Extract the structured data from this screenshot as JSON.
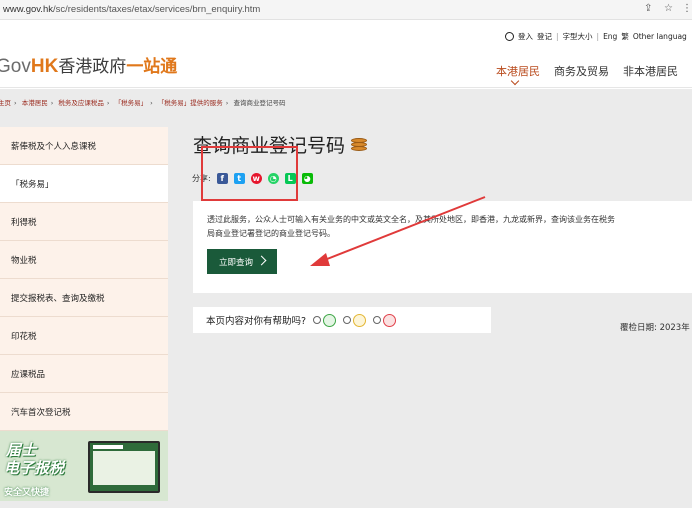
{
  "browser": {
    "url_host": "www.gov.hk",
    "url_path": "/sc/residents/taxes/etax/services/brn_enquiry.htm"
  },
  "header": {
    "logo_gov": "Gov",
    "logo_hk": "HK",
    "logo_cn1": "香港政府",
    "logo_cn2": "一站通",
    "top_links": {
      "login": "登入",
      "register": "登记",
      "font_size": "字型大小",
      "lang_en": "Eng",
      "lang_trad": "繁",
      "other_lang": "Other languag"
    },
    "nav": [
      "本港居民",
      "商务及贸易",
      "非本港居民"
    ]
  },
  "breadcrumb": [
    "主页",
    "本港居民",
    "税务及应课税品",
    "「税务易」",
    "「税务易」提供的服务",
    "查询商业登记号码"
  ],
  "sidebar": {
    "items": [
      "薪俸税及个人入息课税",
      "「税务易」",
      "利得税",
      "物业税",
      "提交报税表、查询及缴税",
      "印花税",
      "应课税品",
      "汽车首次登记税"
    ],
    "banner_line1": "届士",
    "banner_line2": "电子报税",
    "banner_line3": "安全又快捷"
  },
  "main": {
    "title": "查询商业登记号码",
    "share_label": "分享:",
    "description_line1": "透过此服务，公众人士可输入有关业务的中文或英文全名，及其所处地区，即香港，九龙或新界，查询该业务在税务",
    "description_line2": "局商业登记署登记的商业登记号码。",
    "query_button": "立即查询",
    "feedback_question": "本页内容对你有帮助吗?",
    "reviewed_date": "覆检日期: 2023年"
  }
}
